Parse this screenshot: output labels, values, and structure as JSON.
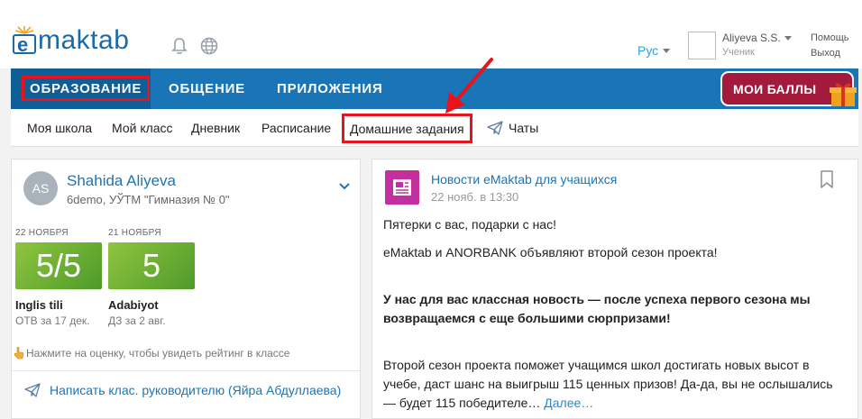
{
  "header": {
    "logo_text": "maktab",
    "logo_letter": "e",
    "language": "Рус",
    "user_name": "Aliyeva S.S.",
    "user_role": "Ученик",
    "help": "Помощь",
    "logout": "Выход"
  },
  "nav": {
    "items": [
      {
        "label": "ОБРАЗОВАНИЕ"
      },
      {
        "label": "ОБЩЕНИЕ"
      },
      {
        "label": "ПРИЛОЖЕНИЯ"
      }
    ],
    "points_button": "МОИ БАЛЛЫ"
  },
  "subnav": {
    "items": [
      {
        "label": "Моя школа"
      },
      {
        "label": "Мой класс"
      },
      {
        "label": "Дневник"
      },
      {
        "label": "Расписание"
      },
      {
        "label": "Домашние задания"
      },
      {
        "label": "Чаты"
      }
    ]
  },
  "profile": {
    "initials": "AS",
    "name": "Shahida Aliyeva",
    "school": "6demo, УЎТМ \"Гимназия № 0\"",
    "grades": [
      {
        "date": "22 НОЯБРЯ",
        "value": "5/5",
        "subject": "Inglis tili",
        "note": "ОТВ за 17 дек."
      },
      {
        "date": "21 НОЯБРЯ",
        "value": "5",
        "subject": "Adabiyot",
        "note": "ДЗ за 2 авг."
      }
    ],
    "hint": "Нажмите на оценку, чтобы увидеть рейтинг в классе",
    "write_teacher": "Написать клас. руководителю (Яйра Абдуллаева)"
  },
  "news": {
    "source": "Новости eMaktab для учащихся",
    "date": "22 нояб. в 13:30",
    "p1": "Пятерки с вас, подарки с нас!",
    "p2": "eMaktab и ANORBANK объявляют второй сезон проекта!",
    "p3": "У нас для вас классная новость — после успеха первого сезона мы возвращаемся с еще большими сюрпризами!",
    "p4": "Второй сезон проекта поможет учащимся школ достигать новых высот в учебе, даст шанс на выигрыш 115 ценных призов! Да-да, вы не ослышались — будет 115 победителе…",
    "more": "Далее…"
  },
  "colors": {
    "nav_blue": "#1a75b6",
    "nav_active": "#0f5e97",
    "highlight_red": "#e8131b",
    "points_bg": "#a31a3d",
    "grade_green": "#6cb033",
    "news_icon": "#c42fa0"
  }
}
